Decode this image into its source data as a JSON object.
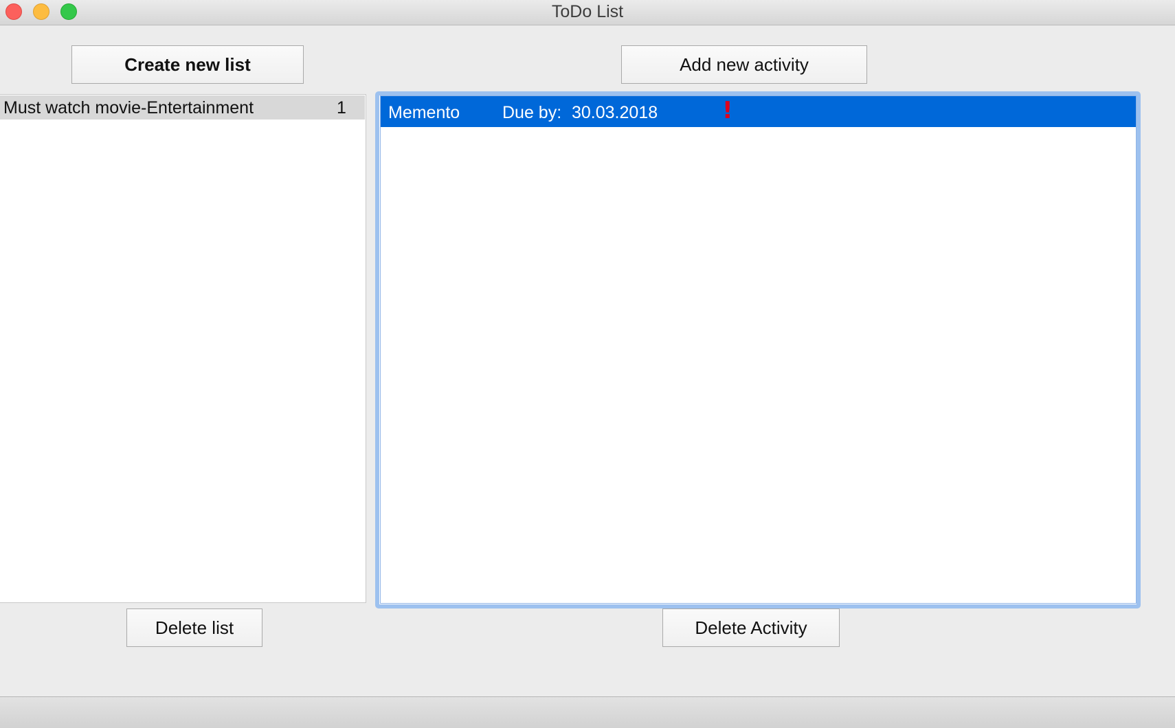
{
  "window": {
    "title": "ToDo List"
  },
  "toolbar": {
    "create_list_label": "Create new list",
    "add_activity_label": "Add new activity",
    "delete_list_label": "Delete list",
    "delete_activity_label": "Delete Activity"
  },
  "lists": [
    {
      "name": "Must watch movie-Entertainment",
      "count": "1",
      "selected": true
    }
  ],
  "activities": [
    {
      "name": "Memento",
      "due_label": "Due by:",
      "due_date": "30.03.2018",
      "priority_mark": "!",
      "selected": true
    }
  ],
  "colors": {
    "selection_blue": "#0068d9",
    "priority_red": "#e0001b",
    "list_selected_gray": "#d8d8d8"
  },
  "icons": {
    "close": "close-button-icon",
    "minimize": "minimize-button-icon",
    "maximize": "maximize-button-icon",
    "priority": "exclamation-icon"
  }
}
